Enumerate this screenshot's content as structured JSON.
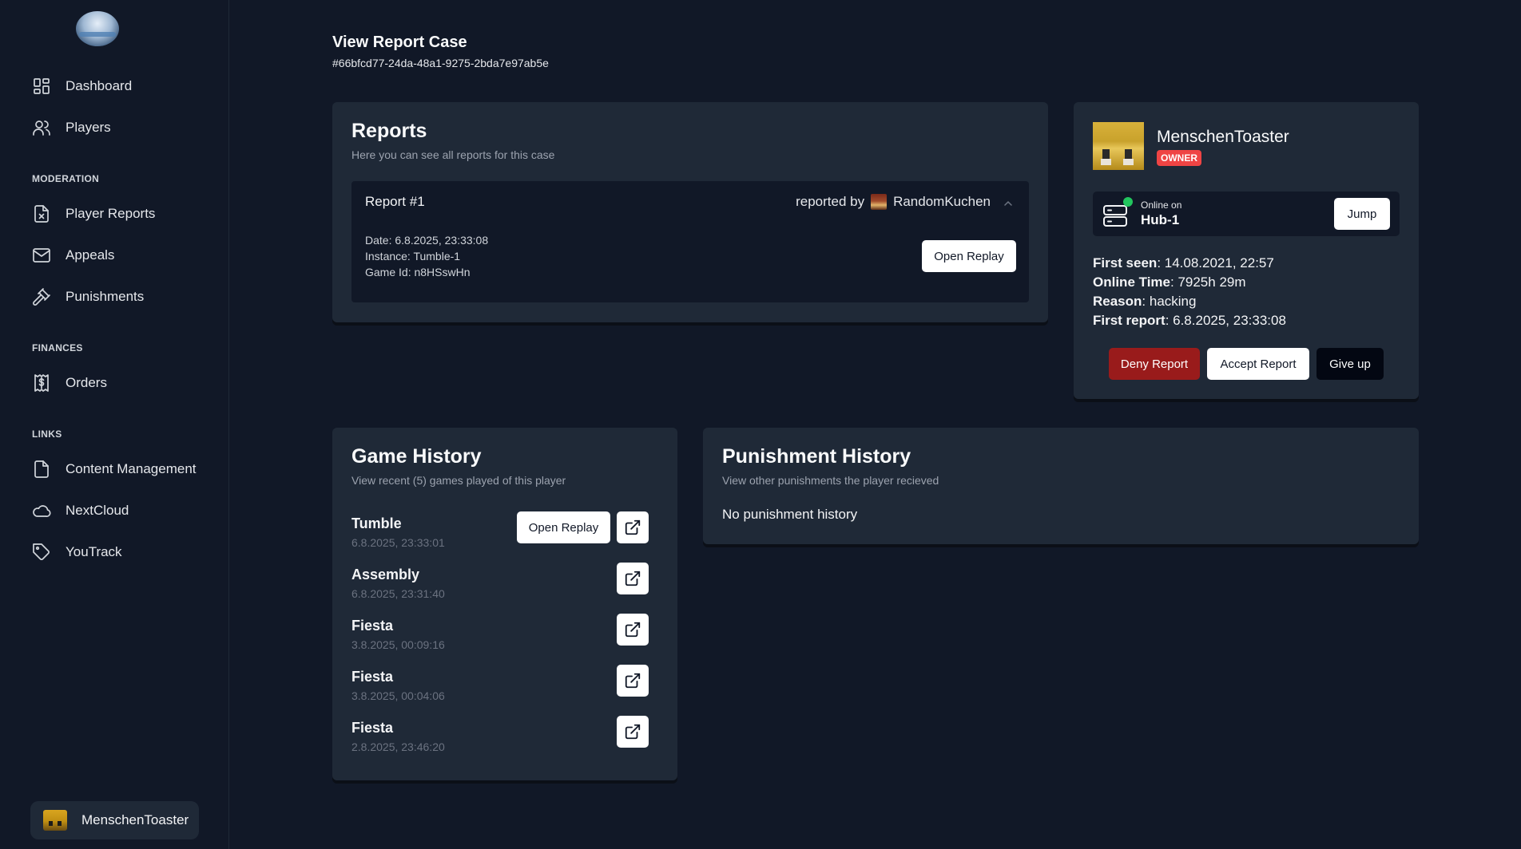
{
  "sidebar": {
    "nav_top": [
      {
        "label": "Dashboard",
        "icon": "dashboard-icon"
      },
      {
        "label": "Players",
        "icon": "users-icon"
      }
    ],
    "sections": [
      {
        "title": "MODERATION",
        "items": [
          {
            "label": "Player Reports",
            "icon": "file-x-icon"
          },
          {
            "label": "Appeals",
            "icon": "mail-icon"
          },
          {
            "label": "Punishments",
            "icon": "gavel-icon"
          }
        ]
      },
      {
        "title": "FINANCES",
        "items": [
          {
            "label": "Orders",
            "icon": "receipt-icon"
          }
        ]
      },
      {
        "title": "LINKS",
        "items": [
          {
            "label": "Content Management",
            "icon": "document-icon"
          },
          {
            "label": "NextCloud",
            "icon": "cloud-icon"
          },
          {
            "label": "YouTrack",
            "icon": "tag-icon"
          }
        ]
      }
    ],
    "user": {
      "name": "MenschenToaster"
    }
  },
  "header": {
    "title": "View Report Case",
    "case_id": "#66bfcd77-24da-48a1-9275-2bda7e97ab5e"
  },
  "reports": {
    "title": "Reports",
    "subtitle": "Here you can see all reports for this case",
    "items": [
      {
        "label": "Report #1",
        "reported_by_prefix": "reported by",
        "reporter": "RandomKuchen",
        "date": "Date: 6.8.2025, 23:33:08",
        "instance": "Instance: Tumble-1",
        "game_id": "Game Id: n8HSswHn",
        "open_replay_label": "Open Replay"
      }
    ]
  },
  "player": {
    "name": "MenschenToaster",
    "badge": "OWNER",
    "online_label": "Online on",
    "online_server": "Hub-1",
    "jump_label": "Jump",
    "first_seen_label": "First seen",
    "first_seen": ": 14.08.2021, 22:57",
    "online_time_label": "Online Time",
    "online_time": ": 7925h 29m",
    "reason_label": "Reason",
    "reason": ": hacking",
    "first_report_label": "First report",
    "first_report": ": 6.8.2025, 23:33:08",
    "deny_label": "Deny Report",
    "accept_label": "Accept Report",
    "giveup_label": "Give up",
    "online_color": "#22c55e",
    "badge_color": "#ef4444",
    "deny_color": "#991b1b"
  },
  "games": {
    "title": "Game History",
    "subtitle": "View recent (5) games played of this player",
    "open_replay_label": "Open Replay",
    "items": [
      {
        "name": "Tumble",
        "date": "6.8.2025, 23:33:01"
      },
      {
        "name": "Assembly",
        "date": "6.8.2025, 23:31:40"
      },
      {
        "name": "Fiesta",
        "date": "3.8.2025, 00:09:16"
      },
      {
        "name": "Fiesta",
        "date": "3.8.2025, 00:04:06"
      },
      {
        "name": "Fiesta",
        "date": "2.8.2025, 23:46:20"
      }
    ]
  },
  "punishments": {
    "title": "Punishment History",
    "subtitle": "View other punishments the player recieved",
    "empty": "No punishment history"
  }
}
